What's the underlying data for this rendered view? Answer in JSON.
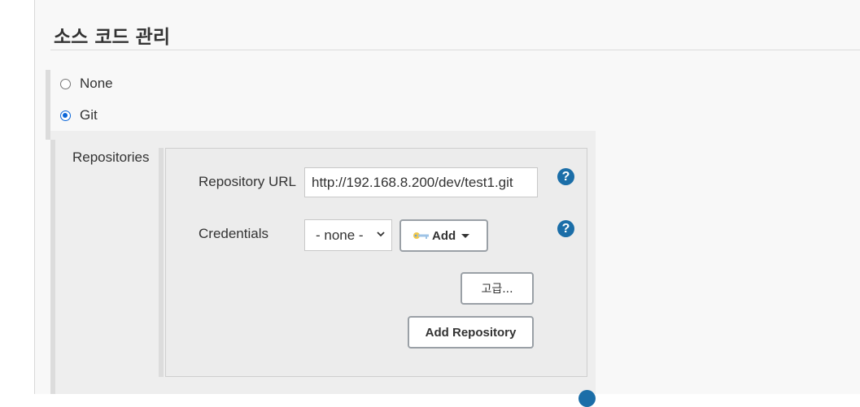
{
  "section": {
    "title": "소스 코드 관리"
  },
  "scm_options": [
    {
      "label": "None",
      "checked": false
    },
    {
      "label": "Git",
      "checked": true
    }
  ],
  "repositories": {
    "label": "Repositories",
    "repository_url": {
      "label": "Repository URL",
      "value": "http://192.168.8.200/dev/test1.git"
    },
    "credentials": {
      "label": "Credentials",
      "selected": "- none -",
      "add_button": "Add"
    },
    "advanced_button": "고급...",
    "add_repository_button": "Add Repository"
  },
  "help_glyph": "?",
  "icons": {
    "help": "help-icon",
    "key": "key-icon",
    "dropdown": "chevron-down-icon"
  },
  "colors": {
    "help_icon": "#1b6ea8",
    "radio_checked": "#0a66d8",
    "panel_background": "#eeeeee"
  }
}
